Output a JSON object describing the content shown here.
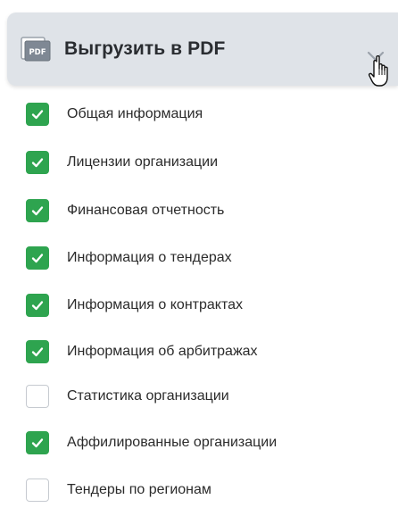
{
  "dropdown": {
    "title": "Выгрузить в PDF",
    "icon": "pdf-file-icon",
    "chevron_icon": "chevron-down-icon",
    "expanded": true
  },
  "options": [
    {
      "label": "Общая информация",
      "checked": true
    },
    {
      "label": "Лицензии организации",
      "checked": true
    },
    {
      "label": "Финансовая отчетность",
      "checked": true
    },
    {
      "label": "Информация о тендерах",
      "checked": true
    },
    {
      "label": "Информация о контрактах",
      "checked": true
    },
    {
      "label": "Информация об арбитражах",
      "checked": true
    },
    {
      "label": "Статистика организации",
      "checked": false
    },
    {
      "label": "Аффилированные организации",
      "checked": true
    },
    {
      "label": "Тендеры по регионам",
      "checked": false
    }
  ],
  "colors": {
    "header_bg": "#dfe3e8",
    "check_green": "#2ea44f",
    "unchecked_border": "#c6cad0"
  }
}
